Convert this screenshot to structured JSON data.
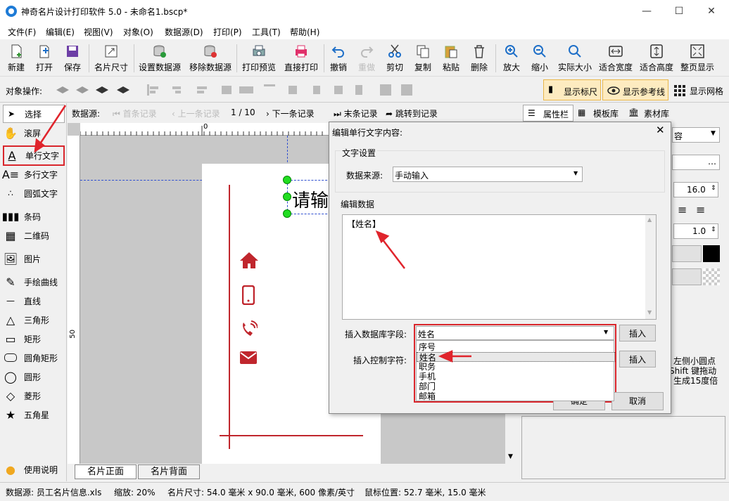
{
  "window": {
    "title": "神奇名片设计打印软件 5.0 - 未命名1.bscp*",
    "minimize": "—",
    "maximize": "☐",
    "close": "✕"
  },
  "menu": [
    "文件(F)",
    "编辑(E)",
    "视图(V)",
    "对象(O)",
    "数据源(D)",
    "打印(P)",
    "工具(T)",
    "帮助(H)"
  ],
  "toolbar": {
    "new": "新建",
    "open": "打开",
    "save": "保存",
    "card_size": "名片尺寸",
    "set_datasource": "设置数据源",
    "remove_datasource": "移除数据源",
    "print_preview": "打印预览",
    "direct_print": "直接打印",
    "undo": "撤销",
    "redo": "重做",
    "cut": "剪切",
    "copy": "复制",
    "paste": "粘贴",
    "delete": "删除",
    "zoom_in": "放大",
    "zoom_out": "缩小",
    "actual_size": "实际大小",
    "fit_width": "适合宽度",
    "fit_height": "适合高度",
    "fit_page": "整页显示"
  },
  "objbar": {
    "label": "对象操作:",
    "show_ruler": "显示标尺",
    "show_guides": "显示参考线",
    "show_grid": "显示网格"
  },
  "tools": {
    "select": "选择",
    "scroll": "滚屏",
    "single_text": "单行文字",
    "multi_text": "多行文字",
    "arc_text": "圆弧文字",
    "barcode": "条码",
    "qrcode": "二维码",
    "image": "图片",
    "freehand": "手绘曲线",
    "line": "直线",
    "triangle": "三角形",
    "rect": "矩形",
    "round_rect": "圆角矩形",
    "circle": "圆形",
    "diamond": "菱形",
    "star": "五角星",
    "help": "使用说明"
  },
  "records": {
    "label": "数据源:",
    "first": "首条记录",
    "prev": "上一条记录",
    "position": "1 / 10",
    "next": "下一条记录",
    "last": "末条记录",
    "goto": "跳转到记录"
  },
  "right": {
    "tab_props": "属性栏",
    "tab_templates": "模板库",
    "tab_materials": "素材库",
    "font_size": "16.0",
    "line_width": "1.0",
    "hint_line1": "左侧小圆点",
    "hint_line2": "Shift 键拖动",
    "hint_line3": "生成15度倍",
    "combo_tail": "容"
  },
  "ruler": {
    "zero": "0",
    "fifty": "50"
  },
  "card": {
    "text_preview": "请输"
  },
  "card_tabs": {
    "front": "名片正面",
    "back": "名片背面"
  },
  "status": {
    "datasource": "数据源: 员工名片信息.xls",
    "zoom": "缩放: 20%",
    "size": "名片尺寸: 54.0 毫米 x 90.0 毫米, 600 像素/英寸",
    "mouse": "鼠标位置: 52.7 毫米, 15.0 毫米"
  },
  "dialog": {
    "title": "编辑单行文字内容:",
    "text_settings": "文字设置",
    "datasource_label": "数据来源:",
    "datasource_value": "手动输入",
    "edit_data": "编辑数据",
    "content": "【姓名】",
    "insert_field_label": "插入数据库字段:",
    "field_value": "姓名",
    "insert": "插入",
    "insert_ctrl_label": "插入控制字符:",
    "insert2": "插入",
    "ok": "确定",
    "cancel": "取消",
    "options": [
      "序号",
      "姓名",
      "职务",
      "手机",
      "部门",
      "邮箱"
    ]
  },
  "colors": {
    "accent_red": "#d9262c",
    "card_red": "#c0262d"
  }
}
